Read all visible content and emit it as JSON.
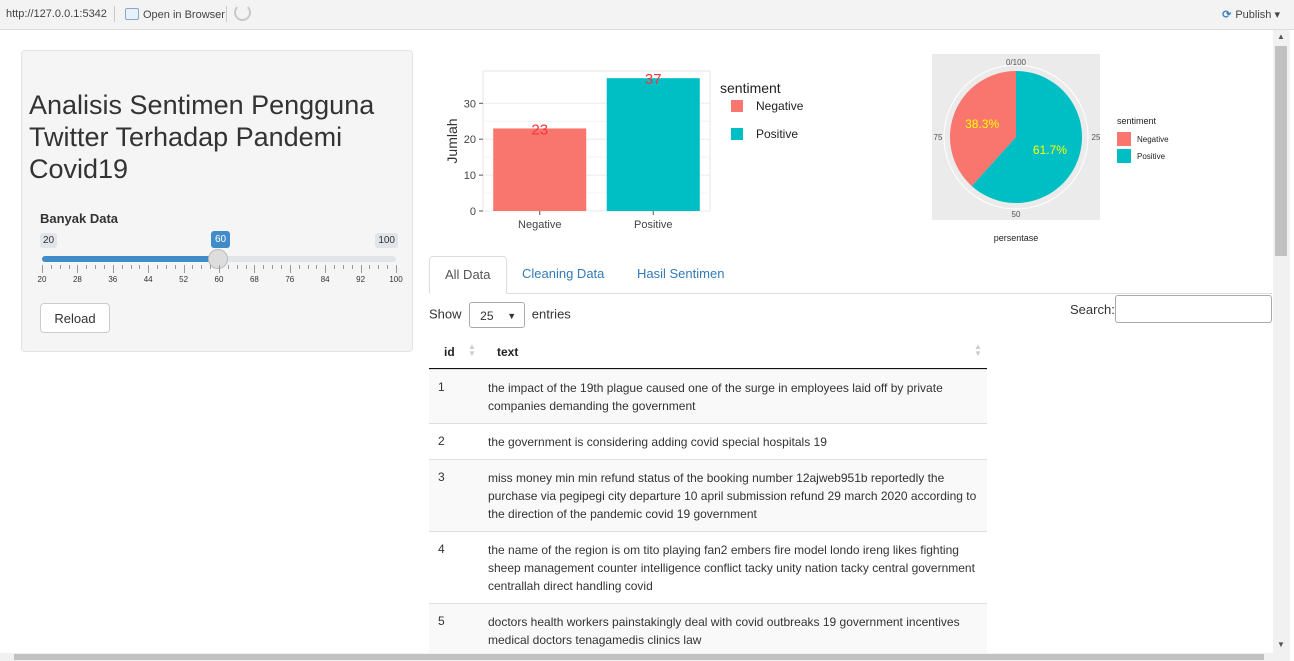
{
  "topbar": {
    "url": "http://127.0.0.1:5342",
    "open_label": "Open in Browser",
    "publish_label": "Publish ▾"
  },
  "sidebar": {
    "title": "Analisis Sentimen Pengguna Twitter Terhadap Pandemi Covid19",
    "slider": {
      "label": "Banyak Data",
      "min": "20",
      "max": "100",
      "value": "60",
      "value_fraction": 0.5,
      "ticks": [
        "20",
        "28",
        "36",
        "44",
        "52",
        "60",
        "68",
        "76",
        "84",
        "92",
        "100"
      ]
    },
    "reload_label": "Reload"
  },
  "chart_data": [
    {
      "type": "bar",
      "categories": [
        "Negative",
        "Positive"
      ],
      "values": [
        23,
        37
      ],
      "data_labels": [
        "23",
        "37"
      ],
      "ylabel": "Jumlah",
      "yticks": [
        0,
        10,
        20,
        30
      ],
      "ylim": [
        0,
        39
      ],
      "legend_title": "sentiment",
      "legend_items": [
        "Negative",
        "Positive"
      ],
      "colors": [
        "#f8766d",
        "#00bfc4"
      ],
      "grid": true,
      "legend_placement": "right"
    },
    {
      "type": "pie",
      "slices": [
        {
          "name": "Negative",
          "value": 38.3,
          "label": "38.3%"
        },
        {
          "name": "Positive",
          "value": 61.7,
          "label": "61.7%"
        }
      ],
      "xlabel": "persentase",
      "angle_ticks": [
        "0/100",
        "25",
        "50",
        "75"
      ],
      "legend_title": "sentiment",
      "legend_items": [
        "Negative",
        "Positive"
      ],
      "colors": [
        "#f8766d",
        "#00bfc4"
      ],
      "label_color": "#ffff00",
      "legend_placement": "right"
    }
  ],
  "tabs": [
    {
      "label": "All Data",
      "active": true
    },
    {
      "label": "Cleaning Data",
      "active": false
    },
    {
      "label": "Hasil Sentimen",
      "active": false
    }
  ],
  "table_controls": {
    "show_label": "Show",
    "entries_value": "25",
    "entries_label": "entries",
    "search_label": "Search:",
    "search_value": ""
  },
  "table": {
    "columns": [
      "id",
      "text"
    ],
    "rows": [
      {
        "id": "1",
        "text": "the impact of the 19th plague caused one of the surge in employees laid off by private companies demanding the government"
      },
      {
        "id": "2",
        "text": "the government is considering adding covid special hospitals 19"
      },
      {
        "id": "3",
        "text": "miss money min min refund status of the booking number 12ajweb951b reportedly the purchase via pegipegi city departure 10 april submission refund 29 march 2020 according to the direction of the pandemic covid 19 government"
      },
      {
        "id": "4",
        "text": "the name of the region is om tito playing fan2 embers fire model londo ireng likes fighting sheep management counter intelligence conflict tacky unity nation tacky central government centrallah direct handling covid"
      },
      {
        "id": "5",
        "text": "doctors health workers painstakingly deal with covid outbreaks 19 government incentives medical doctors tenagamedis clinics law"
      }
    ]
  }
}
